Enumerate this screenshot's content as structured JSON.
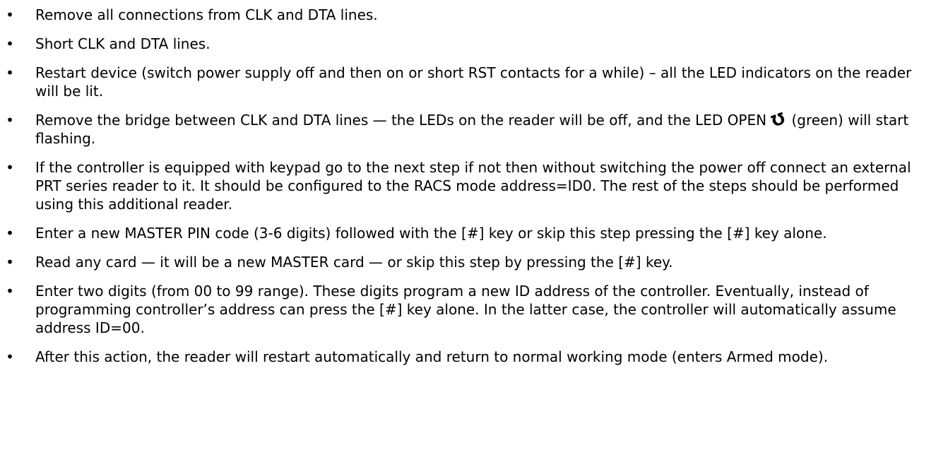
{
  "bullet_symbol": "•",
  "items": [
    {
      "text": "Remove all connections from CLK and DTA lines."
    },
    {
      "text": "Short CLK and DTA lines."
    },
    {
      "text": "Restart device (switch power supply off and then on or short RST contacts for a while) – all the LED indicators on the reader will be lit."
    },
    {
      "text_before": "Remove the bridge between CLK and DTA lines — the LEDs on the reader will be off, and the LED OPEN",
      "icon": "open-door-icon",
      "text_after": "(green) will start flashing."
    },
    {
      "text": "If the controller is equipped with keypad go to the next step if not then without switching the power off connect an external PRT series reader to it. It should be configured to the RACS mode address=ID0. The rest of the steps should be performed using this additional reader."
    },
    {
      "text": "Enter a new MASTER PIN code (3-6 digits) followed with the [#] key or skip this step pressing the [#] key alone."
    },
    {
      "text": "Read any card — it will be a new MASTER card — or skip this step by pressing the [#] key."
    },
    {
      "text": "Enter two digits (from 00 to 99 range). These digits program a new ID address of the controller. Eventually, instead of programming controller’s address can press the [#] key alone. In the latter case, the controller will automatically assume address ID=00."
    },
    {
      "text": "After this action, the reader will restart automatically and return to normal working mode (enters Armed mode)."
    }
  ]
}
